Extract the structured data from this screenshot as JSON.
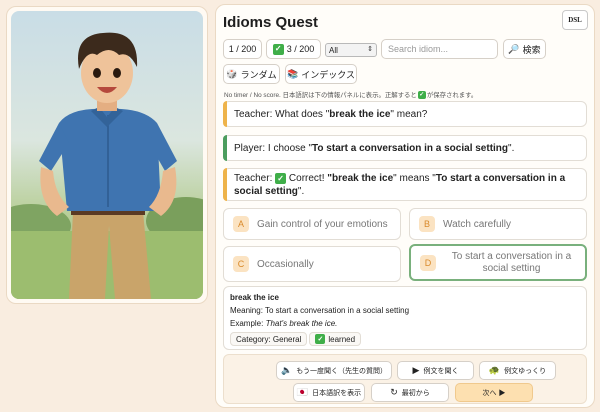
{
  "app": {
    "title": "Idioms Quest",
    "badge": "DSL"
  },
  "toolbar": {
    "progress": "1 / 200",
    "learned_count": "3 / 200",
    "filter_selected": "All",
    "search_placeholder": "Search idiom...",
    "search_button": "検索",
    "random_button": "ランダム",
    "index_button": "インデックス"
  },
  "note": {
    "before": "No timer / No score. 日本語訳は下の情報パネルに表示。正解すると",
    "after": "が保存されます。"
  },
  "dialogue": {
    "q_prefix": "Teacher: What does \"",
    "q_idiom": "break the ice",
    "q_suffix": "\" mean?",
    "a_prefix": "Player: I choose \"",
    "a_choice": "To start a conversation in a social setting",
    "a_suffix": "\".",
    "f_prefix": "Teacher:",
    "f_correct": "Correct!",
    "f_quote1": "\"",
    "f_idiom": "break the ice",
    "f_mid": "\" means \"",
    "f_meaning": "To start a conversation in a social setting",
    "f_end": "\"."
  },
  "options": [
    {
      "letter": "A",
      "text": "Gain control of your emotions"
    },
    {
      "letter": "B",
      "text": "Watch carefully"
    },
    {
      "letter": "C",
      "text": "Occasionally"
    },
    {
      "letter": "D",
      "text": "To start a conversation in a social setting"
    }
  ],
  "info": {
    "word": "break the ice",
    "meaning_label": "Meaning:",
    "meaning": "To start a conversation in a social setting",
    "example_label": "Example:",
    "example": "That's break the ice.",
    "category": "Category: General",
    "learned": "learned"
  },
  "footer": {
    "replay": "もう一度聞く（先生の質問）",
    "listen_example": "例文を聞く",
    "slow_example": "例文ゆっくり",
    "show_translation": "日本語訳を表示",
    "restart": "最初から",
    "next": "次へ ▶"
  },
  "colors": {
    "accent_orange": "#eeb34a",
    "accent_green": "#4c9d5e",
    "check_green": "#3fae49"
  },
  "icons": [
    "speaker-icon",
    "play-icon",
    "turtle-icon",
    "japan-flag-icon",
    "restart-icon",
    "dice-icon",
    "book-icon",
    "magnifier-icon",
    "check-icon"
  ]
}
